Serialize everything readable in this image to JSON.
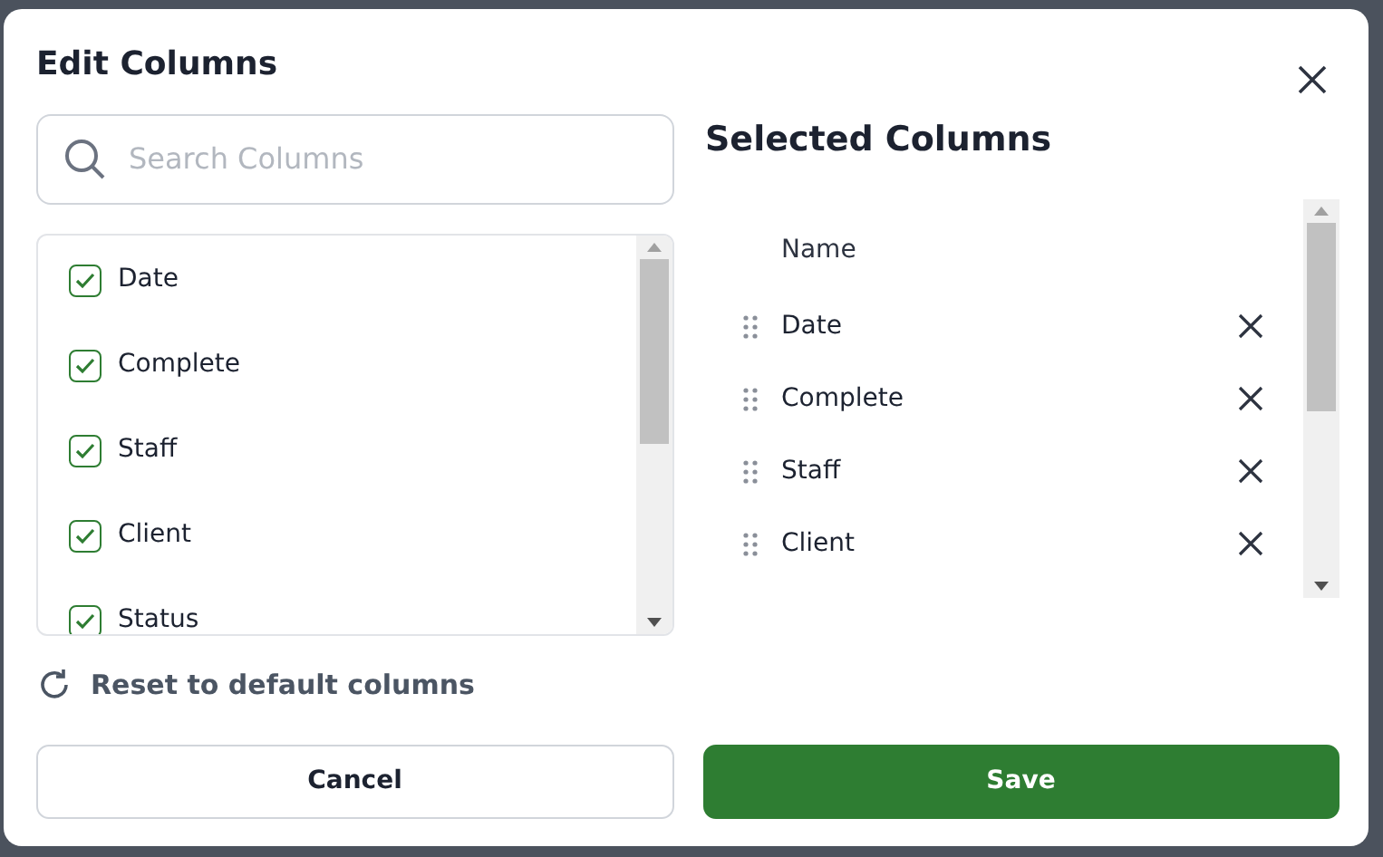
{
  "dialog": {
    "title": "Edit Columns"
  },
  "search": {
    "placeholder": "Search Columns"
  },
  "available_columns": [
    {
      "label": "Date",
      "checked": true
    },
    {
      "label": "Complete",
      "checked": true
    },
    {
      "label": "Staff",
      "checked": true
    },
    {
      "label": "Client",
      "checked": true
    },
    {
      "label": "Status",
      "checked": true
    }
  ],
  "selected_panel": {
    "title": "Selected Columns",
    "header": "Name",
    "rows": [
      {
        "label": "Date"
      },
      {
        "label": "Complete"
      },
      {
        "label": "Staff"
      },
      {
        "label": "Client"
      }
    ]
  },
  "reset_link": "Reset to default columns",
  "buttons": [
    {
      "label": "Cancel",
      "kind": "secondary"
    },
    {
      "label": "Save",
      "kind": "primary"
    }
  ]
}
